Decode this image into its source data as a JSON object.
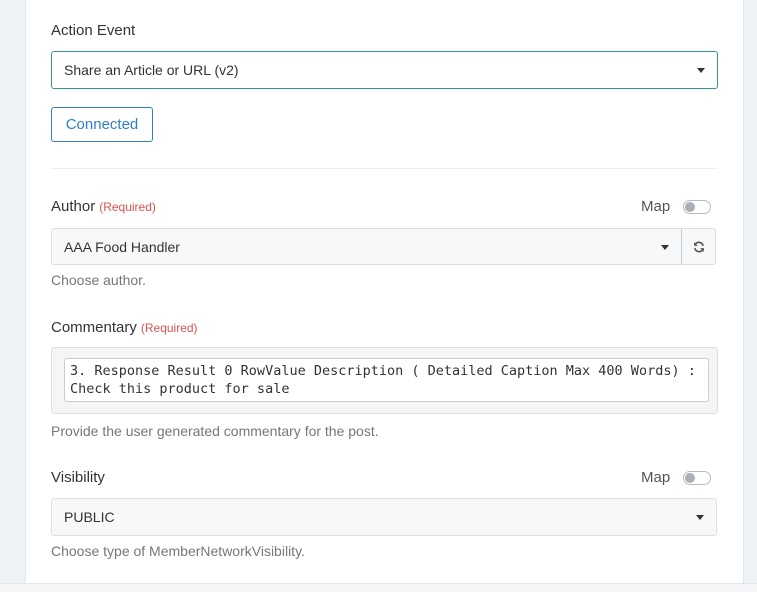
{
  "action_event": {
    "label": "Action Event",
    "selected": "Share an Article or URL (v2)",
    "connection_button": "Connected"
  },
  "author": {
    "label": "Author",
    "required": "(Required)",
    "map_label": "Map",
    "map_enabled": false,
    "selected": "AAA Food Handler",
    "help": "Choose author."
  },
  "commentary": {
    "label": "Commentary",
    "required": "(Required)",
    "value": "3. Response Result 0 RowValue Description ( Detailed Caption Max 400 Words) : Check this product for sale",
    "help": "Provide the user generated commentary for the post."
  },
  "visibility": {
    "label": "Visibility",
    "map_label": "Map",
    "map_enabled": false,
    "selected": "PUBLIC",
    "help": "Choose type of MemberNetworkVisibility."
  },
  "colors": {
    "accent": "#2f80c6",
    "required": "#d9534f"
  },
  "icons": {
    "dropdown": "chevron-down-icon",
    "refresh": "refresh-icon"
  }
}
